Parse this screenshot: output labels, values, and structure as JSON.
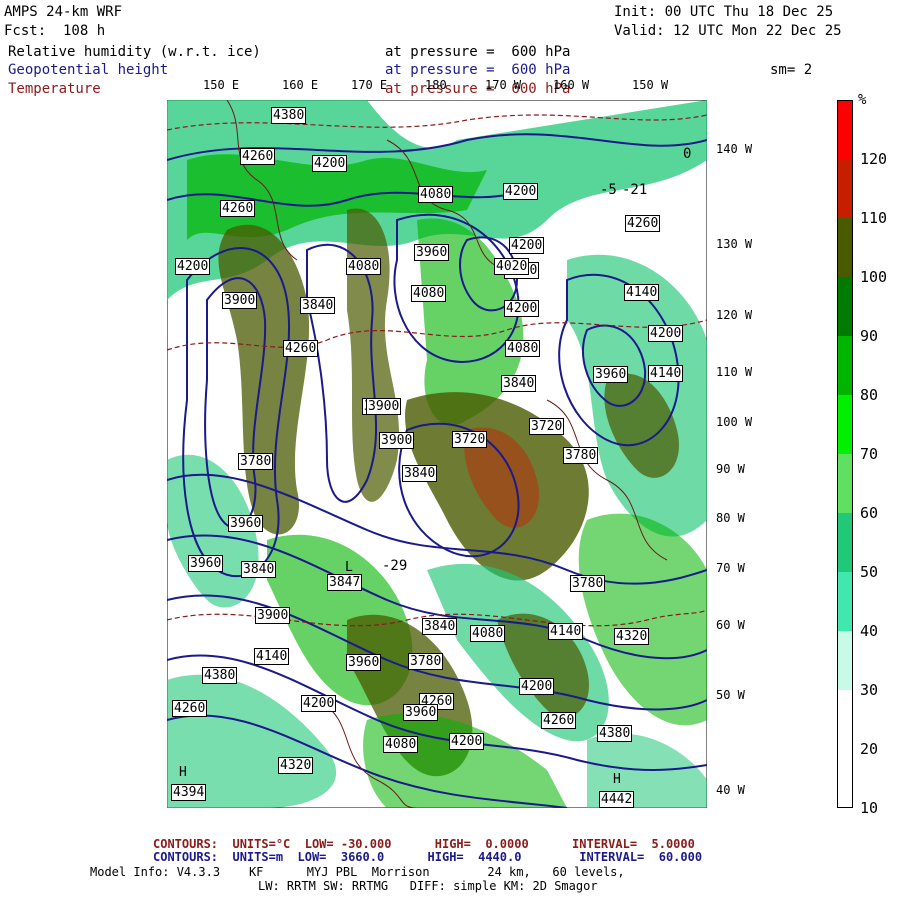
{
  "header": {
    "model": "AMPS 24-km WRF",
    "fcst": "Fcst:  108 h",
    "init": "Init: 00 UTC Thu 18 Dec 25",
    "valid": "Valid: 12 UTC Mon 22 Dec 25",
    "fields": [
      {
        "name": "Relative humidity (w.r.t. ice)",
        "level": "at pressure =  600 hPa"
      },
      {
        "name": "Geopotential height",
        "level": "at pressure =  600 hPa"
      },
      {
        "name": "Temperature",
        "level": "at pressure =  600 hPa"
      }
    ],
    "smoothing": "sm= 2"
  },
  "lon_labels_top": [
    "150 E",
    "160 E",
    "170 E",
    "180",
    "170 W",
    "160 W",
    "150 W"
  ],
  "lon_labels_right": [
    "140 W",
    "130 W",
    "120 W",
    "110 W",
    "100 W",
    "90 W",
    "80 W",
    "70 W",
    "60 W",
    "50 W",
    "40 W"
  ],
  "colorbar": {
    "unit": "%",
    "ticks": [
      "120",
      "110",
      "100",
      "90",
      "80",
      "70",
      "60",
      "50",
      "40",
      "30",
      "20",
      "10"
    ],
    "colors": [
      "#ff0000",
      "#c81e00",
      "#4a5a00",
      "#007a00",
      "#00b400",
      "#00f000",
      "#60e060",
      "#20c878",
      "#40e8b0",
      "#c8fae8",
      "#ffffff",
      "#ffffff"
    ]
  },
  "height_labels": [
    "4380",
    "4260",
    "4200",
    "4080",
    "4200",
    "4260",
    "4200",
    "4260",
    "4200",
    "4080",
    "3900",
    "3840",
    "3960",
    "4080",
    "4020",
    "4200",
    "4080",
    "4200",
    "4140",
    "4200",
    "4260",
    "3840",
    "3900",
    "3720",
    "3780",
    "3720",
    "3900",
    "3840",
    "3780",
    "3960",
    "3840",
    "3960",
    "3780",
    "3900",
    "3840",
    "4080",
    "4140",
    "4320",
    "4380",
    "4260",
    "4200",
    "4260",
    "4080",
    "4320",
    "4200",
    "4200",
    "4260",
    "4380",
    "4140",
    "3960",
    "3960",
    "4140",
    "3960",
    "3840",
    "3780"
  ],
  "pressure_marks": [
    {
      "type": "H",
      "value": "4394"
    },
    {
      "type": "H",
      "value": "4442"
    },
    {
      "type": "L",
      "value": "3847"
    }
  ],
  "temp_labels": [
    "0",
    "-5",
    "-29",
    "-21"
  ],
  "footer": {
    "contour1": "CONTOURS:  UNITS=°C  LOW= -30.000      HIGH=  0.0000      INTERVAL=  5.0000",
    "contour2": "CONTOURS:  UNITS=m  LOW=  3660.0      HIGH=  4440.0        INTERVAL=  60.000",
    "model_info": "Model Info: V4.3.3    KF      MYJ PBL  Morrison        24 km,   60 levels,",
    "physics": "LW: RRTM SW: RRTMG   DIFF: simple KM: 2D Smagor"
  },
  "colors": {
    "height": "#1a1a8c",
    "temperature": "#8b1a1a"
  }
}
